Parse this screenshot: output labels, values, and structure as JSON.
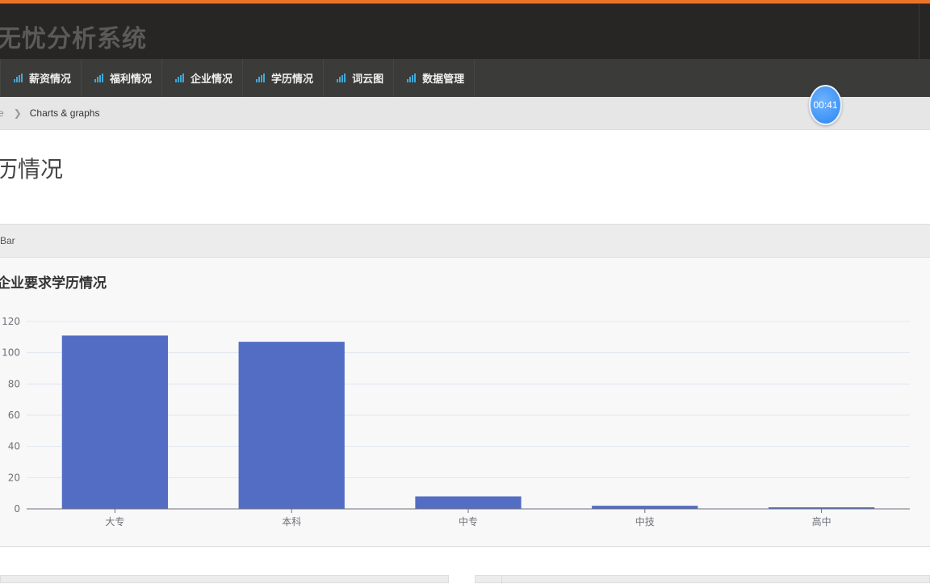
{
  "header": {
    "title": "无忧分析系统"
  },
  "nav": {
    "items": [
      {
        "label": "薪资情况"
      },
      {
        "label": "福利情况"
      },
      {
        "label": "企业情况"
      },
      {
        "label": "学历情况"
      },
      {
        "label": "词云图"
      },
      {
        "label": "数据管理"
      }
    ]
  },
  "breadcrumb": {
    "home": "e",
    "current": "Charts & graphs"
  },
  "timer": "00:41",
  "page": {
    "title": "历情况"
  },
  "panel": {
    "heading": "Bar"
  },
  "colors": {
    "bar": "#536dc4",
    "accent": "#e8732a",
    "nav_icon": "#3fa9d8"
  },
  "chart_data": {
    "type": "bar",
    "title": "企业要求学历情况",
    "categories": [
      "大专",
      "本科",
      "中专",
      "中技",
      "高中"
    ],
    "values": [
      111,
      107,
      8,
      2,
      1
    ],
    "ylim": [
      0,
      120
    ],
    "yticks": [
      0,
      20,
      40,
      60,
      80,
      100,
      120
    ],
    "grid": true
  }
}
